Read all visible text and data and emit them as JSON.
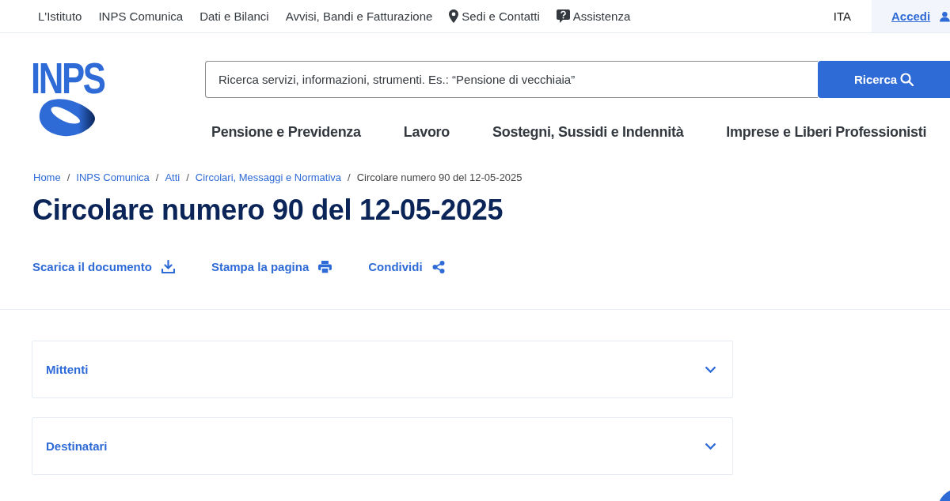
{
  "top_bar": {
    "links": [
      {
        "label": "L'Istituto",
        "kind": "plain"
      },
      {
        "label": "INPS Comunica",
        "kind": "plain"
      },
      {
        "label": "Dati e Bilanci",
        "kind": "plain"
      },
      {
        "label": "Avvisi, Bandi e Fatturazione",
        "kind": "plain"
      },
      {
        "label": "Sedi e Contatti",
        "kind": "location"
      },
      {
        "label": "Assistenza",
        "kind": "help"
      }
    ],
    "language": "ITA",
    "login": "Accedi"
  },
  "header": {
    "logo": "INPS",
    "search": {
      "placeholder": "Ricerca servizi, informazioni, strumenti. Es.: “Pensione di vecchiaia”",
      "button": "Ricerca"
    },
    "nav": [
      "Pensione e Previdenza",
      "Lavoro",
      "Sostegni, Sussidi e Indennità",
      "Imprese e Liberi Professionisti"
    ]
  },
  "breadcrumb": [
    {
      "label": "Home",
      "current": false
    },
    {
      "separator": "/",
      "label": "INPS Comunica",
      "current": false
    },
    {
      "separator": "/",
      "label": "Atti",
      "current": false
    },
    {
      "separator": "/",
      "label": "Circolari, Messaggi e Normativa",
      "current": false
    },
    {
      "separator": "/",
      "label": "Circolare numero 90 del 12-05-2025",
      "current": true
    }
  ],
  "title": "Circolare numero 90 del 12-05-2025",
  "actions": [
    {
      "label": "Scarica il documento",
      "kind": "download"
    },
    {
      "label": "Stampa la pagina",
      "kind": "print"
    },
    {
      "label": "Condividi",
      "kind": "share"
    }
  ],
  "accordions": [
    {
      "label": "Mittenti",
      "expanded": false
    },
    {
      "label": "Destinatari",
      "expanded": false
    }
  ]
}
